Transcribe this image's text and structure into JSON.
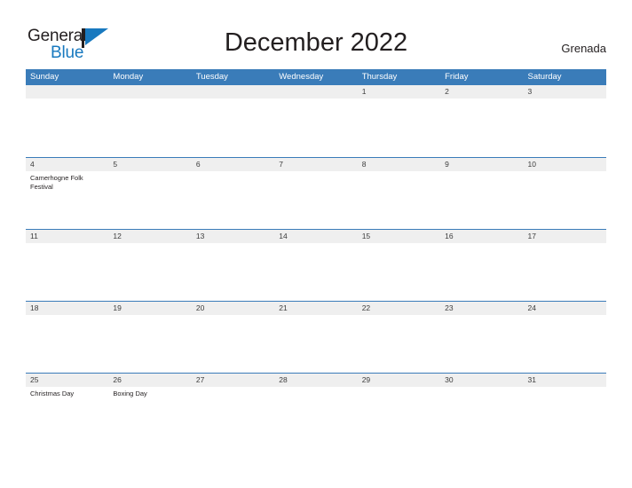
{
  "header": {
    "logo": {
      "word1": "General",
      "word2": "Blue",
      "flag_icon": "blue-triangle-flag-icon",
      "accent_color": "#1879bf"
    },
    "title": "December 2022",
    "country": "Grenada"
  },
  "calendar": {
    "header_color": "#3a7cb9",
    "band_color": "#efefef",
    "weekdays": [
      "Sunday",
      "Monday",
      "Tuesday",
      "Wednesday",
      "Thursday",
      "Friday",
      "Saturday"
    ],
    "weeks": [
      [
        {
          "day": "",
          "events": []
        },
        {
          "day": "",
          "events": []
        },
        {
          "day": "",
          "events": []
        },
        {
          "day": "",
          "events": []
        },
        {
          "day": "1",
          "events": []
        },
        {
          "day": "2",
          "events": []
        },
        {
          "day": "3",
          "events": []
        }
      ],
      [
        {
          "day": "4",
          "events": [
            "Camerhogne Folk Festival"
          ]
        },
        {
          "day": "5",
          "events": []
        },
        {
          "day": "6",
          "events": []
        },
        {
          "day": "7",
          "events": []
        },
        {
          "day": "8",
          "events": []
        },
        {
          "day": "9",
          "events": []
        },
        {
          "day": "10",
          "events": []
        }
      ],
      [
        {
          "day": "11",
          "events": []
        },
        {
          "day": "12",
          "events": []
        },
        {
          "day": "13",
          "events": []
        },
        {
          "day": "14",
          "events": []
        },
        {
          "day": "15",
          "events": []
        },
        {
          "day": "16",
          "events": []
        },
        {
          "day": "17",
          "events": []
        }
      ],
      [
        {
          "day": "18",
          "events": []
        },
        {
          "day": "19",
          "events": []
        },
        {
          "day": "20",
          "events": []
        },
        {
          "day": "21",
          "events": []
        },
        {
          "day": "22",
          "events": []
        },
        {
          "day": "23",
          "events": []
        },
        {
          "day": "24",
          "events": []
        }
      ],
      [
        {
          "day": "25",
          "events": [
            "Christmas Day"
          ]
        },
        {
          "day": "26",
          "events": [
            "Boxing Day"
          ]
        },
        {
          "day": "27",
          "events": []
        },
        {
          "day": "28",
          "events": []
        },
        {
          "day": "29",
          "events": []
        },
        {
          "day": "30",
          "events": []
        },
        {
          "day": "31",
          "events": []
        }
      ]
    ]
  }
}
